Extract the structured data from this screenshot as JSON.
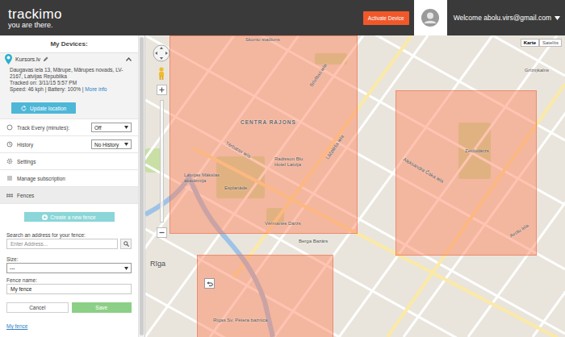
{
  "header": {
    "logo": "trackimo",
    "tagline": "you are there.",
    "activate_button": "Activate Device",
    "welcome": "Welcome abolu.virs@gmail.com"
  },
  "sidebar": {
    "title": "My Devices:",
    "device": {
      "name": "Kursors.lv",
      "expanded": true,
      "address": "Daugavas iela 13, Mārupe, Mārupes novads, LV-2167, Latvijas Republika",
      "tracked_on": "Tracked on: 3/11/15 5:57 PM",
      "speed": "Speed: 46 kph | Battery: 100% |",
      "more_info": "More info",
      "update_button": "Update location"
    },
    "menu": [
      {
        "label": "Track Every (minutes):",
        "kind": "select",
        "value": "Off",
        "selected": false
      },
      {
        "label": "History",
        "kind": "select",
        "value": "No History",
        "selected": false
      },
      {
        "label": "Settings",
        "kind": "plain",
        "value": "",
        "selected": false
      },
      {
        "label": "Manage subscription",
        "kind": "plain",
        "value": "",
        "selected": false
      },
      {
        "label": "Fences",
        "kind": "plain",
        "value": "",
        "selected": true
      }
    ],
    "fence_form": {
      "create_button": "Create a new fence",
      "search_label": "Search an address for your fence:",
      "search_placeholder": "Enter Address...",
      "size_label": "Size:",
      "size_value": "---",
      "name_label": "Fence name:",
      "name_value": "My fence",
      "cancel": "Cancel",
      "save": "Save"
    },
    "fence_list": [
      {
        "name": "My fence"
      }
    ]
  },
  "map": {
    "types": [
      {
        "label": "Karte",
        "selected": true
      },
      {
        "label": "Satelīts",
        "selected": false
      }
    ],
    "labels": [
      {
        "text": "Skonto stadions"
      },
      {
        "text": "CENTRA RAJONS"
      },
      {
        "text": "Radisson Blu Hotel Latvija"
      },
      {
        "text": "Latvijas Mākslas akadēmija"
      },
      {
        "text": "Esplanāde"
      },
      {
        "text": "Vērmanes Dārzs"
      },
      {
        "text": "Berga Bazārs"
      },
      {
        "text": "Zeidodārzs"
      },
      {
        "text": "Rīga"
      },
      {
        "text": "Grīziņkalns"
      },
      {
        "text": "Avotu iela"
      },
      {
        "text": "Rīgas Sv. Pētera baznīca"
      },
      {
        "text": "Brīvības iela"
      },
      {
        "text": "Lāčplēša iela"
      },
      {
        "text": "Aleksandra Čaka iela"
      },
      {
        "text": "Tērbatas iela"
      }
    ]
  }
}
